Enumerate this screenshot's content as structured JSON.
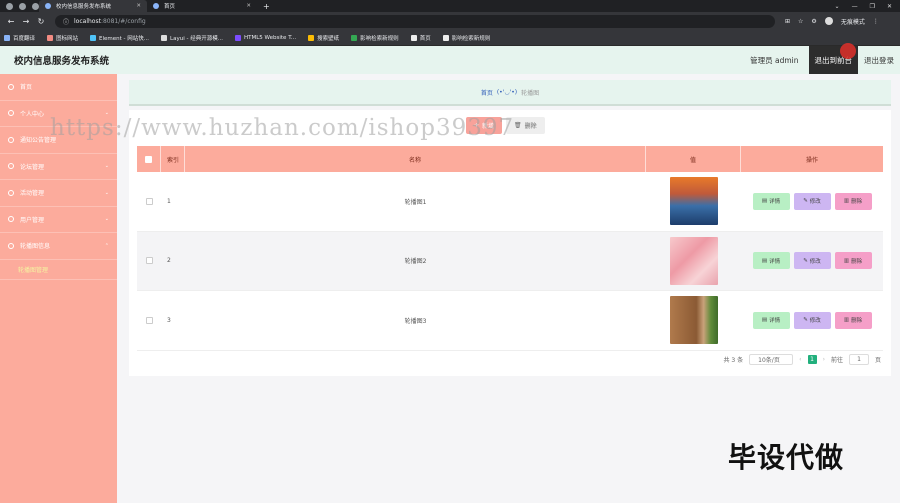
{
  "browser": {
    "tabs": [
      {
        "title": "校内信息服务发布系统",
        "active": true
      },
      {
        "title": "首页",
        "active": false
      }
    ],
    "url_host": "localhost",
    "url_path": ":8081/#/config",
    "profile_label": "无痕模式",
    "bookmarks": [
      {
        "label": "百度翻译"
      },
      {
        "label": "图标网站"
      },
      {
        "label": "Element - 网站快..."
      },
      {
        "label": "Layui - 经典开源模..."
      },
      {
        "label": "HTML5 Website T..."
      },
      {
        "label": "搜索壁纸"
      },
      {
        "label": "影响检索新规则"
      },
      {
        "label": "首页"
      },
      {
        "label": "影响检索新规则"
      }
    ]
  },
  "header": {
    "title": "校内信息服务发布系统",
    "admin_label": "管理员 admin",
    "exit_front_label": "退出到前台",
    "logout_label": "退出登录"
  },
  "sidebar": {
    "items": [
      {
        "label": "首页"
      },
      {
        "label": "个人中心"
      },
      {
        "label": "通知公告管理"
      },
      {
        "label": "论坛管理"
      },
      {
        "label": "活动管理"
      },
      {
        "label": "用户管理"
      },
      {
        "label": "轮播图信息"
      }
    ],
    "sub_item": "轮播图管理"
  },
  "breadcrumb": {
    "home": "首页",
    "sep": "(•'◡'•)",
    "current": "轮播图"
  },
  "toolbar": {
    "add_label": "新增",
    "delete_label": "删除"
  },
  "table": {
    "headers": {
      "index": "索引",
      "name": "名称",
      "value": "值",
      "ops": "操作"
    },
    "rows": [
      {
        "index": "1",
        "name": "轮播图1"
      },
      {
        "index": "2",
        "name": "轮播图2"
      },
      {
        "index": "3",
        "name": "轮播图3"
      }
    ],
    "op_labels": {
      "detail": "详情",
      "edit": "修改",
      "delete": "删除"
    }
  },
  "pager": {
    "total": "共 3 条",
    "page_size": "10条/页",
    "current_page": "1",
    "goto_label": "前往",
    "goto_value": "1",
    "page_unit": "页"
  },
  "overlay": {
    "watermark": "https://www.huzhan.com/ishop39397",
    "corner": "毕设代做"
  }
}
